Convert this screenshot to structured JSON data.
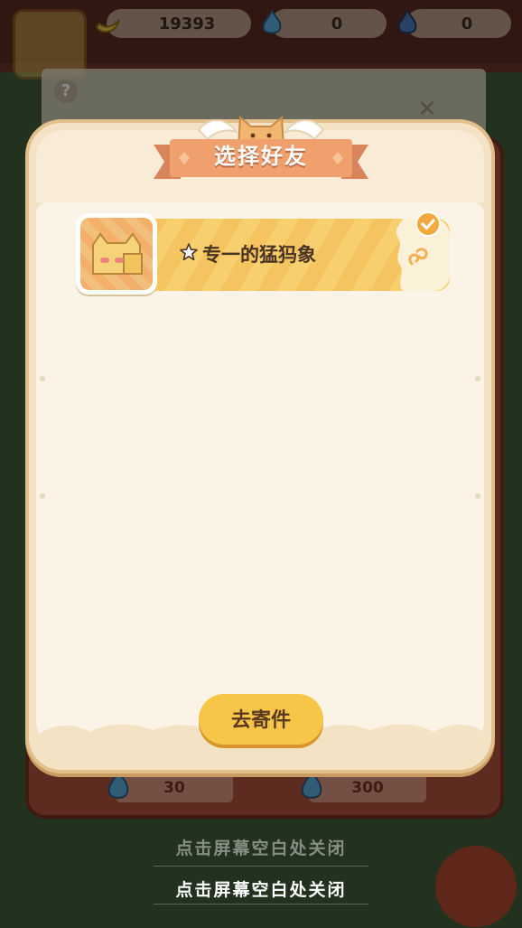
{
  "topbar": {
    "currency_banana": "19393",
    "currency_blue_fire": "0",
    "currency_dark_fire": "0"
  },
  "rewards": [
    "30",
    "300"
  ],
  "hints": {
    "close_hint_faded": "点击屏幕空白处关闭",
    "close_hint": "点击屏幕空白处关闭"
  },
  "modal": {
    "title": "选择好友",
    "friends": [
      {
        "name": "专一的猛犸象",
        "selected": true
      }
    ],
    "send_button": "去寄件"
  },
  "colors": {
    "accent_yellow": "#f7c548",
    "ribbon_orange": "#f0a06c",
    "check_orange": "#f3a93c"
  }
}
